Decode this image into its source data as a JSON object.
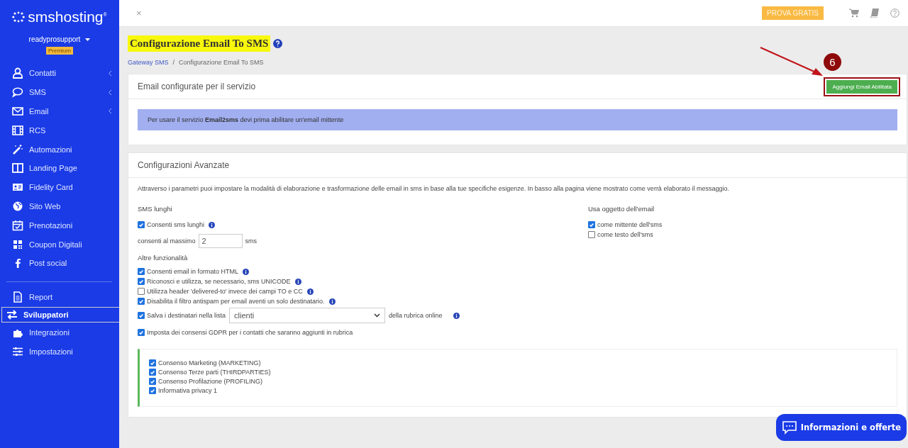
{
  "sidebar": {
    "logo": "smshosting$^{®}$",
    "user": "readyprosupport",
    "plan_badge": "Premium",
    "items": [
      {
        "label": "Contatti",
        "expandable": true,
        "selected": false
      },
      {
        "label": "SMS",
        "expandable": true,
        "selected": false
      },
      {
        "label": "Email",
        "expandable": true,
        "selected": false
      },
      {
        "label": "RCS",
        "expandable": false,
        "selected": false
      },
      {
        "label": "Automazioni",
        "expandable": false,
        "selected": false
      },
      {
        "label": "Landing Page",
        "expandable": false,
        "selected": false
      },
      {
        "label": "Fidelity Card",
        "expandable": false,
        "selected": false
      },
      {
        "label": "Sito Web",
        "expandable": false,
        "selected": false
      },
      {
        "label": "Prenotazioni",
        "expandable": false,
        "selected": false
      },
      {
        "label": "Coupon Digitali",
        "expandable": false,
        "selected": false
      },
      {
        "label": "Post social",
        "expandable": false,
        "selected": false
      }
    ],
    "bottom_items": [
      {
        "label": "Report",
        "selected": false
      },
      {
        "label": "Sviluppatori",
        "selected": true
      },
      {
        "label": "Integrazioni",
        "selected": false
      },
      {
        "label": "Impostazioni",
        "selected": false
      }
    ]
  },
  "topbar": {
    "close": "×",
    "trial_button": "PROVA GRATIS"
  },
  "page": {
    "title": "Configurazione Email To SMS",
    "breadcrumb": [
      "Gateway SMS",
      "Configurazione Email To SMS"
    ],
    "breadcrumb_separator": "/"
  },
  "email_card": {
    "title": "Email configurate per il servizio",
    "button": "Aggiungi Email Abilitata",
    "annotation": "6",
    "alert": "Per usare il servizio **Email2sms** devi prima abilitare un'email mittente"
  },
  "advanced_card": {
    "title": "Configurazioni Avanzate",
    "intro": "Attraverso i parametri puoi impostare la modalità di elaborazione e trasformazione delle email in sms in base alla tue specifiche esigenze. In basso alla pagina viene mostrato come verrà elaborato il messaggio.",
    "long_sms": {
      "heading": "SMS lunghi",
      "option": {
        "label": "Consenti sms lunghi",
        "checked": true
      },
      "max_label": "consenti al massimo",
      "max_value": "2",
      "max_unit": "sms"
    },
    "other_heading": "Altre funzionalità",
    "options": [
      {
        "kind": "check",
        "label": "Consenti email in formato HTML",
        "checked": true
      },
      {
        "kind": "check",
        "label": "Riconosci e utilizza, se necessario, sms UNICODE",
        "checked": true
      },
      {
        "kind": "check",
        "label": "Utilizza header 'delivered-to' invece dei campi TO e CC",
        "checked": false
      },
      {
        "kind": "check",
        "label": "Disabilita il filtro antispam per email aventi un solo destinatario.",
        "checked": true
      },
      {
        "kind": "select",
        "label": "Salva i destinatari nella lista",
        "checked": true,
        "value": "clienti",
        "suffix": "della rubrica online"
      }
    ],
    "gdpr": {
      "label": "Imposta dei consensi GDPR per i contatti che saranno aggiunti in rubrica",
      "checked": true
    },
    "consents": [
      {
        "label": "Consenso Marketing (MARKETING)",
        "checked": true
      },
      {
        "label": "Consenso Terze parti (THIRDPARTIES)",
        "checked": true
      },
      {
        "label": "Consenso Profilazione (PROFILING)",
        "checked": true
      },
      {
        "label": "Informativa privacy 1",
        "checked": true
      }
    ],
    "subject": {
      "heading": "Usa oggetto dell'email",
      "options": [
        {
          "label": "come mittente dell'sms",
          "checked": true
        },
        {
          "label": "come testo dell'sms",
          "checked": false
        }
      ]
    }
  },
  "chat_button": "Informazioni e offerte"
}
